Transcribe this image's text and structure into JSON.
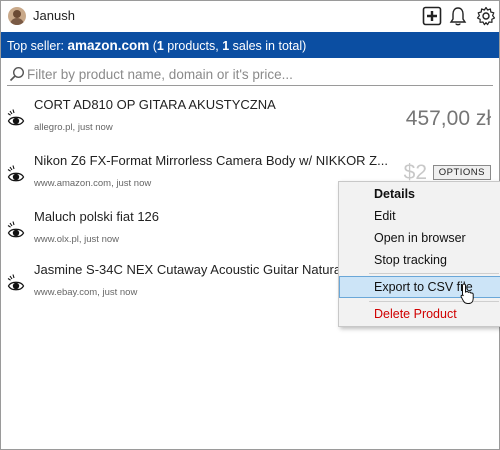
{
  "header": {
    "username": "Janush",
    "icons": [
      "add-icon",
      "bell-icon",
      "gear-icon"
    ]
  },
  "banner": {
    "prefix": "Top seller: ",
    "domain": "amazon.com",
    "open_paren": " (",
    "products_count": "1",
    "products_text": " products, ",
    "sales_count": "1",
    "sales_text": " sales in total)",
    "background": "#0b4ea2"
  },
  "search": {
    "placeholder": "Filter by product name, domain or it's price...",
    "value": ""
  },
  "products": [
    {
      "title": "CORT AD810 OP GITARA AKUSTYCZNA",
      "meta": "allegro.pl, just now",
      "price": "457,00 zł"
    },
    {
      "title": "Nikon Z6 FX-Format Mirrorless Camera Body w/ NIKKOR Z...",
      "meta": "www.amazon.com, just now",
      "price": "$2",
      "options_label": "OPTIONS"
    },
    {
      "title": "Maluch polski fiat 126",
      "meta": "www.olx.pl, just now"
    },
    {
      "title": "Jasmine S-34C NEX Cutaway Acoustic Guitar Natural",
      "meta": "www.ebay.com, just now"
    }
  ],
  "context_menu": {
    "items": [
      {
        "label": "Details"
      },
      {
        "label": "Edit"
      },
      {
        "label": "Open in browser"
      },
      {
        "label": "Stop tracking"
      },
      {
        "label": "Export to CSV file"
      },
      {
        "label": "Delete Product"
      }
    ],
    "highlight_color": "#cce4f7",
    "danger_color": "#d00000"
  }
}
